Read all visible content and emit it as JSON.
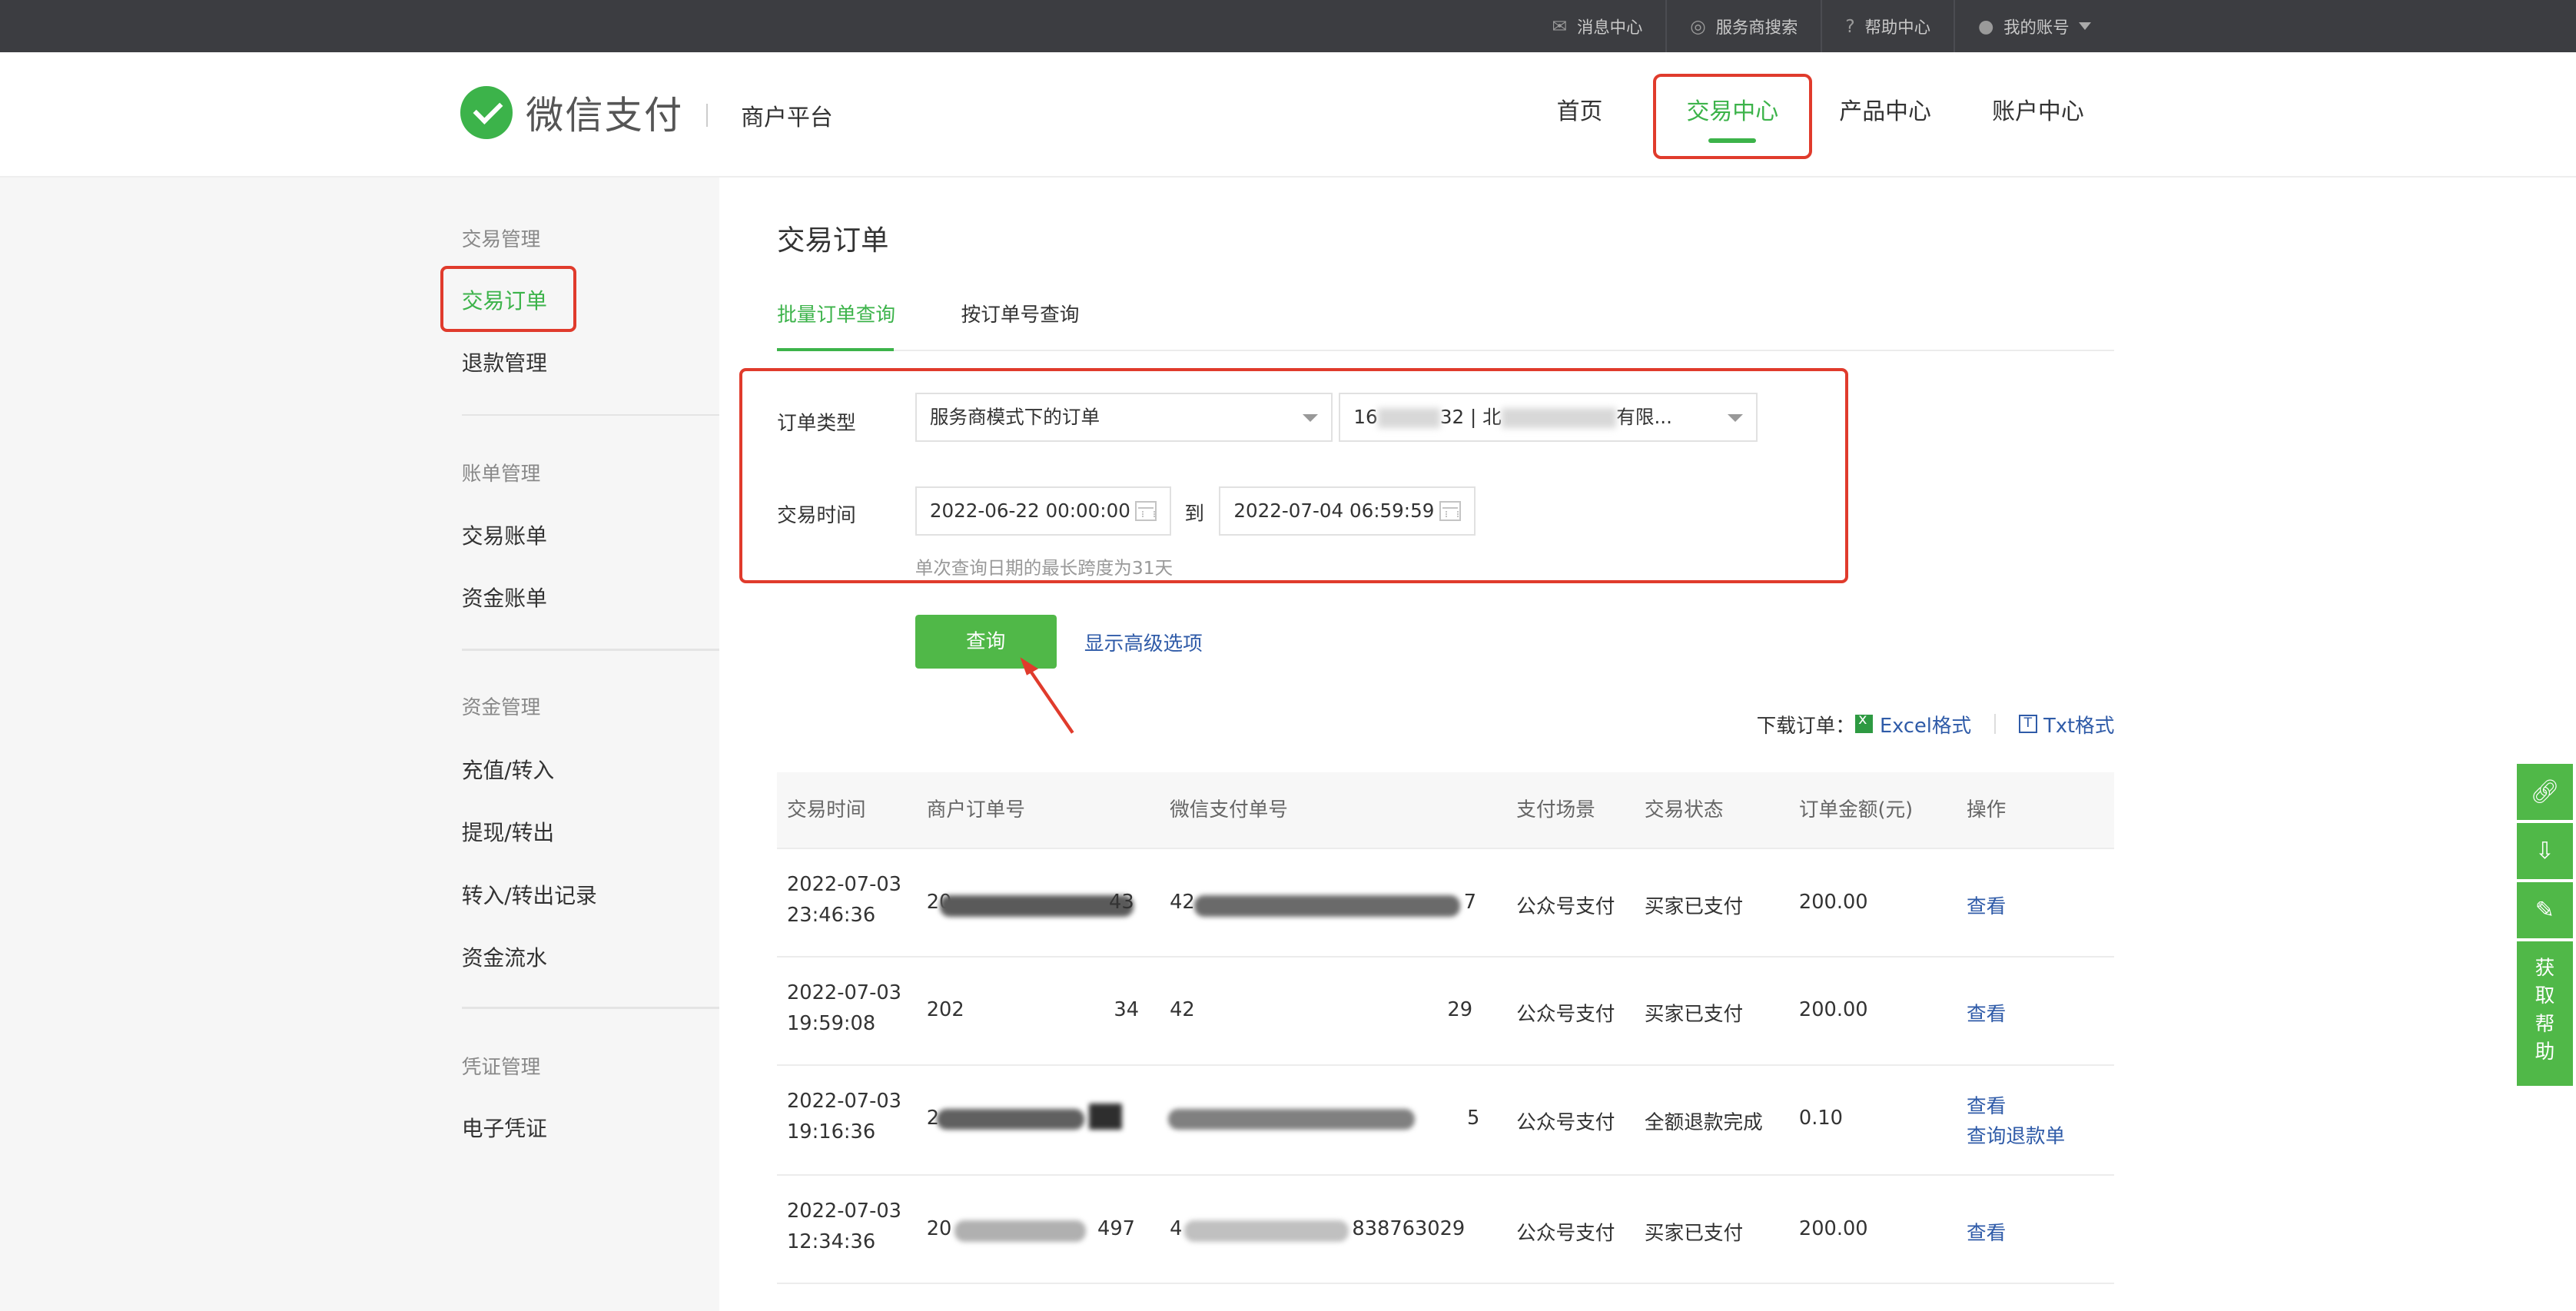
{
  "topbar": {
    "items": [
      {
        "label": "消息中心",
        "icon": "mail-icon"
      },
      {
        "label": "服务商搜索",
        "icon": "search-icon"
      },
      {
        "label": "帮助中心",
        "icon": "help-icon"
      },
      {
        "label": "我的账号",
        "icon": "user-icon"
      }
    ]
  },
  "header": {
    "brand": "微信支付",
    "platform": "商户平台",
    "nav": [
      "首页",
      "交易中心",
      "产品中心",
      "账户中心"
    ],
    "active_nav": "交易中心"
  },
  "sidebar": {
    "groups": [
      {
        "title": "交易管理",
        "items": [
          "交易订单",
          "退款管理"
        ]
      },
      {
        "title": "账单管理",
        "items": [
          "交易账单",
          "资金账单"
        ]
      },
      {
        "title": "资金管理",
        "items": [
          "充值/转入",
          "提现/转出",
          "转入/转出记录",
          "资金流水"
        ]
      },
      {
        "title": "凭证管理",
        "items": [
          "电子凭证"
        ]
      }
    ],
    "active_item": "交易订单"
  },
  "main": {
    "title": "交易订单",
    "tabs": [
      "批量订单查询",
      "按订单号查询"
    ],
    "active_tab": "批量订单查询",
    "filters": {
      "order_type_label": "订单类型",
      "order_type_value": "服务商模式下的订单",
      "merchant_value_start": "16",
      "merchant_value_mid": "32 | 北",
      "merchant_value_end": "有限...",
      "time_label": "交易时间",
      "start_time": "2022-06-22 00:00:00",
      "to_label": "到",
      "end_time": "2022-07-04 06:59:59",
      "hint": "单次查询日期的最长跨度为31天"
    },
    "query_button": "查询",
    "advanced_link": "显示高级选项",
    "download": {
      "label": "下载订单：",
      "excel": "Excel格式",
      "txt": "Txt格式"
    },
    "table": {
      "headers": [
        "交易时间",
        "商户订单号",
        "微信支付单号",
        "支付场景",
        "交易状态",
        "订单金额(元)",
        "操作"
      ],
      "rows": [
        {
          "date": "2022-07-03",
          "time": "23:46:36",
          "merchant_no_start": "20",
          "merchant_no_end": "43",
          "wx_no_start": "42",
          "wx_no_end": "7",
          "scene": "公众号支付",
          "status": "买家已支付",
          "amount": "200.00",
          "actions": [
            "查看"
          ]
        },
        {
          "date": "2022-07-03",
          "time": "19:59:08",
          "merchant_no_start": "202",
          "merchant_no_end": "34",
          "wx_no_start": "42",
          "wx_no_end": "29",
          "scene": "公众号支付",
          "status": "买家已支付",
          "amount": "200.00",
          "actions": [
            "查看"
          ]
        },
        {
          "date": "2022-07-03",
          "time": "19:16:36",
          "merchant_no_start": "2",
          "merchant_no_end": "",
          "wx_no_start": "",
          "wx_no_end": "5",
          "scene": "公众号支付",
          "status": "全额退款完成",
          "amount": "0.10",
          "actions": [
            "查看",
            "查询退款单"
          ]
        },
        {
          "date": "2022-07-03",
          "time": "12:34:36",
          "merchant_no_start": "20",
          "merchant_no_end": "497",
          "wx_no_start": "4",
          "wx_no_end": "838763029",
          "scene": "公众号支付",
          "status": "买家已支付",
          "amount": "200.00",
          "actions": [
            "查看"
          ]
        }
      ]
    }
  },
  "right_tools": {
    "buttons": [
      "link-icon",
      "download-icon",
      "edit-icon"
    ],
    "help": "获取帮助"
  },
  "colors": {
    "accent": "#3cb34a",
    "highlight": "#e03b2c",
    "link": "#2f5ba8"
  }
}
